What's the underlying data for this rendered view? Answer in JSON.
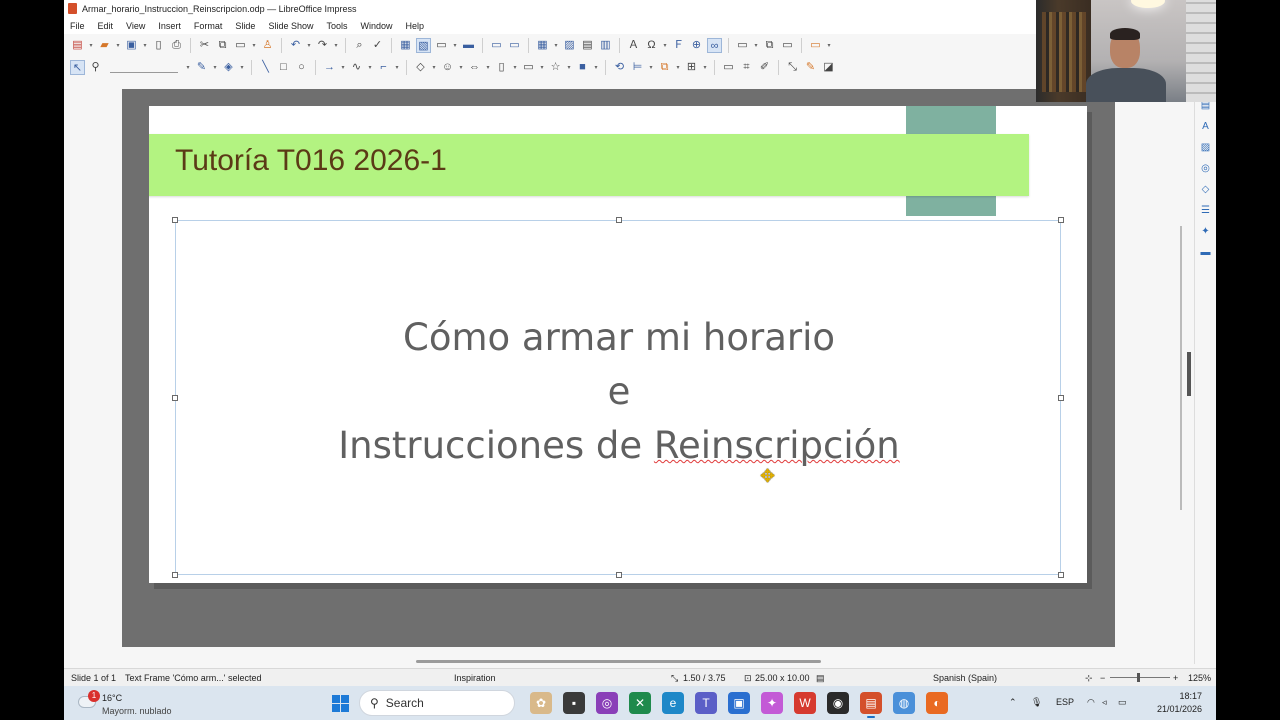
{
  "window": {
    "title": "Armar_horario_Instruccion_Reinscripcion.odp — LibreOffice Impress"
  },
  "menu": [
    "File",
    "Edit",
    "View",
    "Insert",
    "Format",
    "Slide",
    "Slide Show",
    "Tools",
    "Window",
    "Help"
  ],
  "slide": {
    "title": "Tutoría T016 2026-1",
    "body_lines": [
      "Cómo armar mi horario",
      "e",
      "Instrucciones de Reinscripción"
    ],
    "body_line3_prefix": "Instrucciones de ",
    "body_line3_spell": "Reinscripción",
    "accent_band_color": "#b3f381",
    "accent_rect_color": "#7fb1a0",
    "title_color": "#5b3a16"
  },
  "status": {
    "slide_info": "Slide 1 of 1",
    "selection": "Text Frame 'Cómo arm...' selected",
    "master": "Inspiration",
    "position": "1.50 / 3.75",
    "size": "25.00 x 10.00",
    "language": "Spanish (Spain)",
    "zoom": "125%"
  },
  "taskbar": {
    "weather_temp": "16°C",
    "weather_desc": "Mayorm. nublado",
    "weather_badge": "1",
    "search_label": "Search",
    "language": "ESP",
    "time": "18:17",
    "date": "21/01/2026"
  }
}
